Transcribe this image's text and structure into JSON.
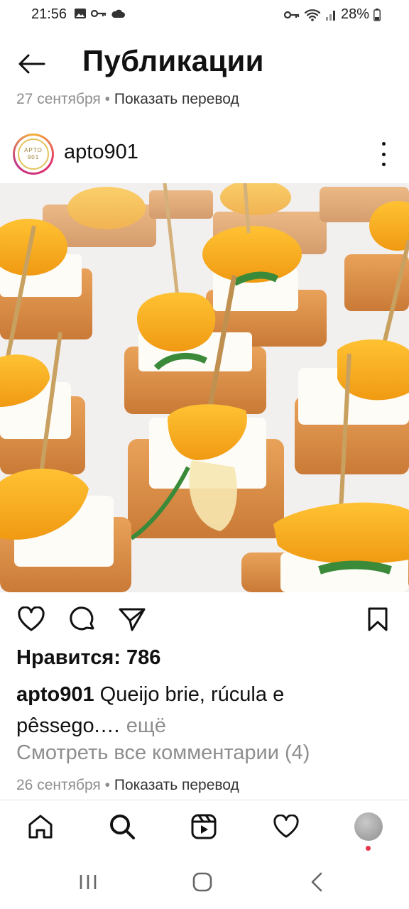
{
  "status_bar": {
    "time": "21:56",
    "battery": "28%",
    "left_icons": [
      "image-icon",
      "key-icon",
      "cloud-icon"
    ],
    "right_icons": [
      "key-icon",
      "wifi-icon",
      "signal-icon",
      "battery-icon"
    ]
  },
  "header": {
    "title": "Публикации",
    "date": "27 сентября",
    "separator": "•",
    "translate_label": "Показать перевод"
  },
  "post": {
    "username": "apto901",
    "avatar_text_top": "APTO",
    "avatar_text_bottom": "901",
    "image_description_icon": "food-photo",
    "likes": "Нравится: 786",
    "caption_user": "apto901",
    "caption_text": " Queijo brie, rúcula e pêssego.… ",
    "caption_more": "ещё",
    "view_comments": "Смотреть все комментарии (4)",
    "date": "26 сентября",
    "separator": "•",
    "translate_label": "Показать перевод"
  },
  "actions": {
    "icons": [
      "heart-icon",
      "comment-icon",
      "share-icon",
      "bookmark-icon"
    ]
  },
  "bottom_nav": {
    "items": [
      "home-icon",
      "search-icon",
      "reels-icon",
      "heart-icon",
      "profile-avatar"
    ]
  },
  "system_nav": {
    "items": [
      "recents-icon",
      "home-icon",
      "back-icon"
    ]
  },
  "colors": {
    "text": "#111111",
    "secondary": "#8e8e8e",
    "notification": "#e8334a",
    "peach": "#f5a623"
  }
}
